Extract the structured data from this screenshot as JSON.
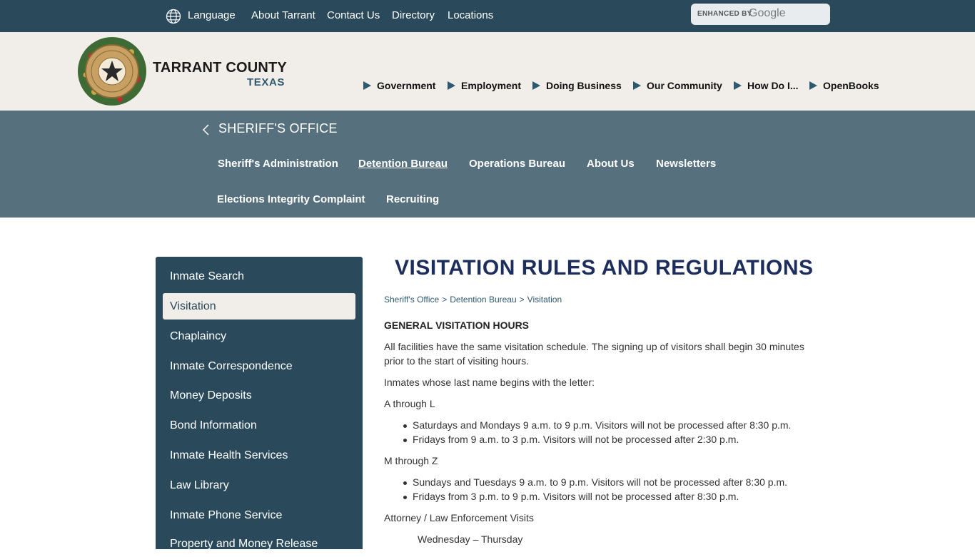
{
  "topbar": {
    "language": "Language",
    "links": [
      "About Tarrant",
      "Contact Us",
      "Directory",
      "Locations"
    ],
    "search": {
      "enhanced_by": "ENHANCED BY",
      "google": "Google"
    }
  },
  "brand": {
    "name": "TARRANT COUNTY",
    "state": "TEXAS"
  },
  "main_nav": [
    "Government",
    "Employment",
    "Doing Business",
    "Our Community",
    "How Do I...",
    "OpenBooks"
  ],
  "department": {
    "title": "SHERIFF'S OFFICE",
    "nav": [
      "Sheriff's Administration",
      "Detention Bureau",
      "Operations Bureau",
      "About Us",
      "Newsletters",
      "Elections Integrity Complaint",
      "Recruiting"
    ],
    "active": "Detention Bureau"
  },
  "sidebar": {
    "items": [
      "Inmate Search",
      "Visitation",
      "Chaplaincy",
      "Inmate Correspondence",
      "Money Deposits",
      "Bond Information",
      "Inmate Health Services",
      "Law Library",
      "Inmate Phone Service",
      "Property and Money Release"
    ],
    "active": "Visitation"
  },
  "content": {
    "title": "VISITATION RULES AND REGULATIONS",
    "breadcrumb": [
      "Sheriff's Office",
      "Detention Bureau",
      "Visitation"
    ],
    "heading": "GENERAL VISITATION HOURS",
    "intro_line1": "All facilities have the same visitation schedule. The signing up of visitors shall begin 30 minutes",
    "intro_line2": "prior to the start of visiting hours.",
    "letters_intro": "Inmates whose last name begins with the letter:",
    "group_a": {
      "label": "A through L",
      "items": [
        "Saturdays and Mondays 9 a.m. to 9 p.m.  Visitors will not be processed after 8:30 p.m.",
        "Fridays from 9 a.m. to 3 p.m. Visitors will not be processed after 2:30 p.m."
      ]
    },
    "group_m": {
      "label": "M through Z",
      "items": [
        "Sundays and Tuesdays 9 a.m. to 9 p.m. Visitors will not be processed after 8:30 p.m.",
        "Fridays from 3 p.m. to 9 p.m. Visitors will not be processed after 8:30 p.m."
      ]
    },
    "attorney_label": "Attorney / Law Enforcement Visits",
    "attorney_days": "Wednesday – Thursday"
  },
  "colors": {
    "topbar": "#2a4a5c",
    "header": "#f1eee9",
    "dept_band": "#56707e",
    "title": "#1d2d5c",
    "accent": "#2e5a70"
  }
}
